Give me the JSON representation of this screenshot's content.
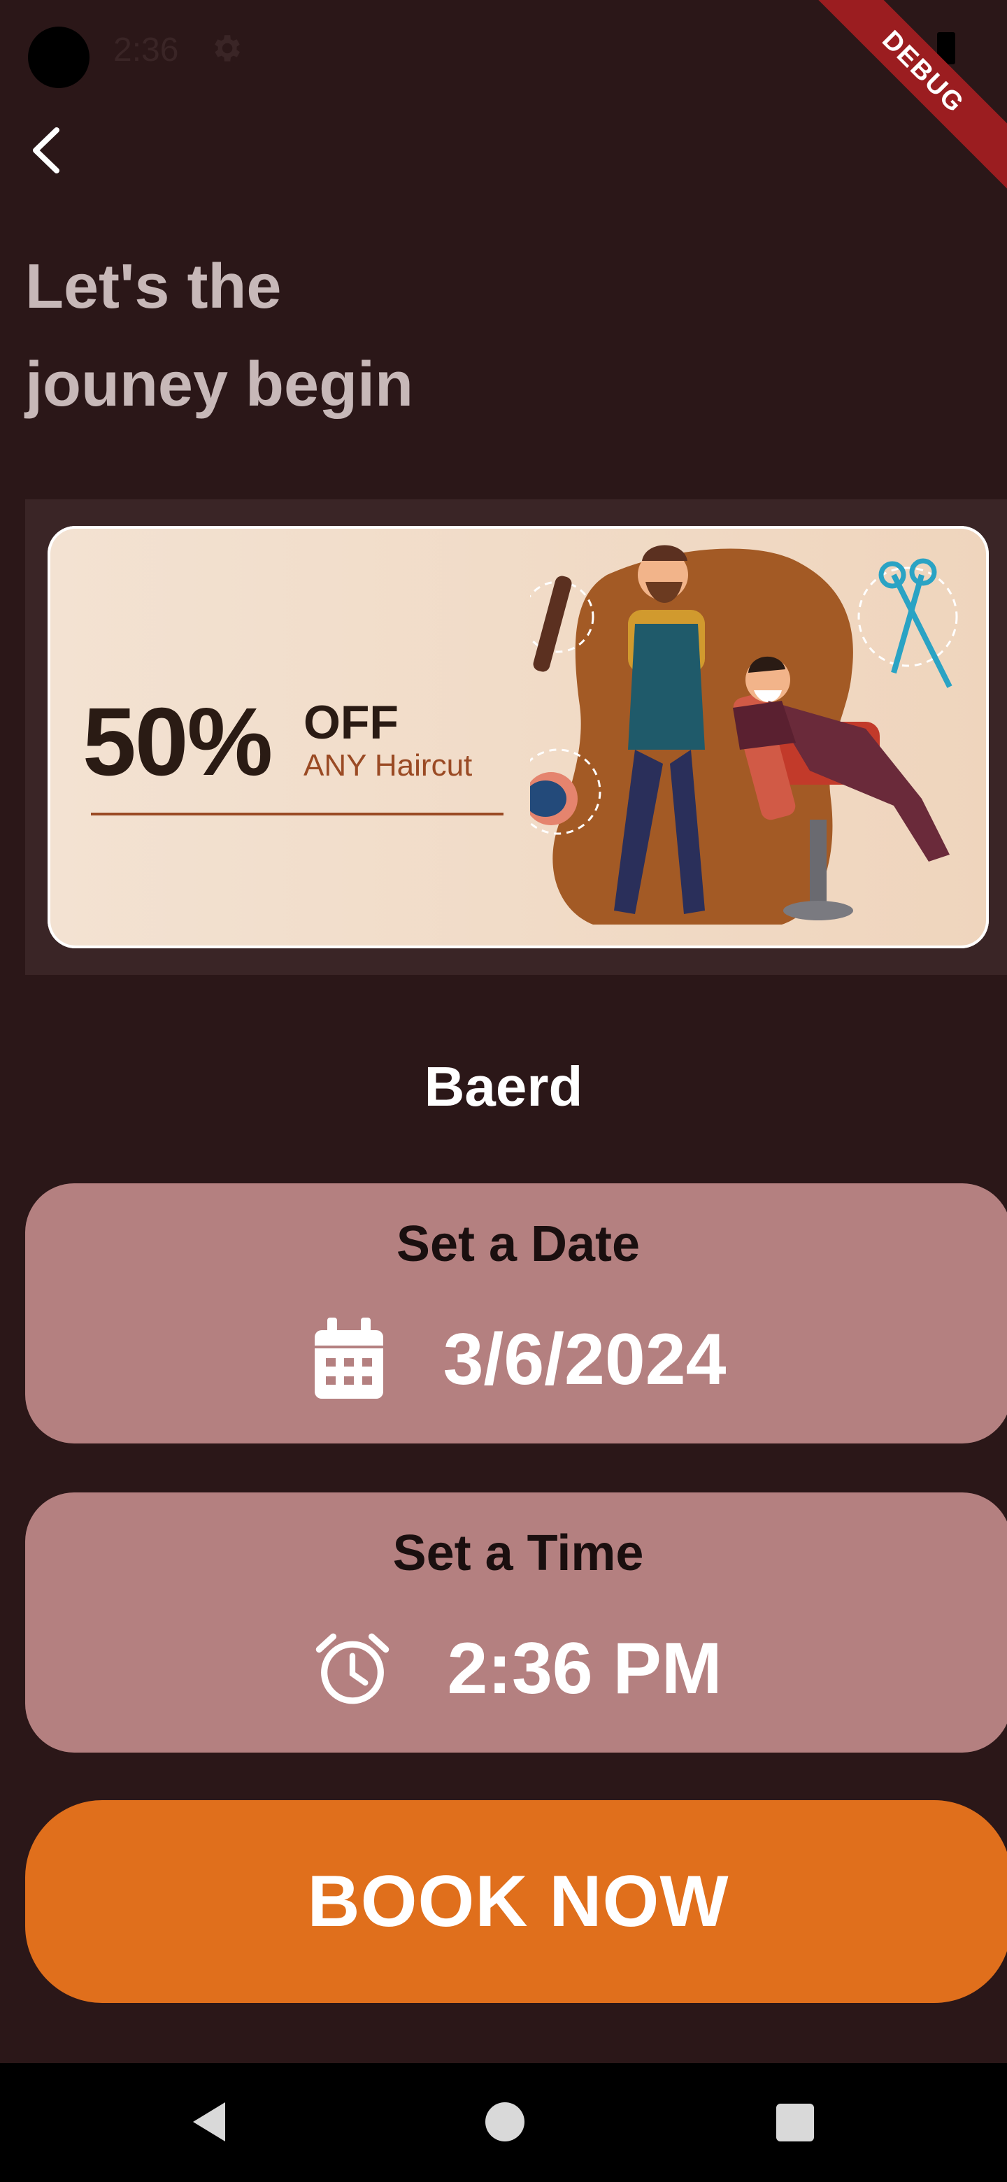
{
  "status_bar": {
    "time": "2:36"
  },
  "debug_banner": "DEBUG",
  "header": {
    "title_line1": "Let's the",
    "title_line2": "jouney begin"
  },
  "promo": {
    "percent": "50%",
    "off": "OFF",
    "subtitle": "ANY Haircut"
  },
  "service": {
    "name": "Baerd"
  },
  "date_picker": {
    "title": "Set a Date",
    "value": "3/6/2024",
    "icon": "calendar-icon"
  },
  "time_picker": {
    "title": "Set a Time",
    "value": "2:36 PM",
    "icon": "alarm-clock-icon"
  },
  "book_button": {
    "label": "BOOK NOW"
  },
  "colors": {
    "background": "#2b1718",
    "card": "#b48080",
    "accent": "#e06f1c",
    "headline": "#c7b8b8"
  }
}
